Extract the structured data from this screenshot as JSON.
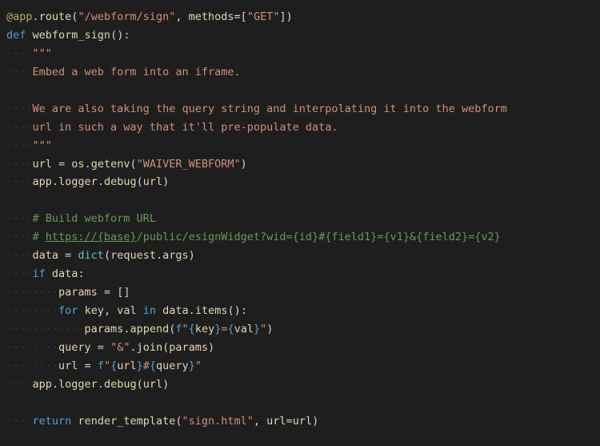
{
  "code": {
    "lines": [
      {
        "indent": 0,
        "segments": [
          {
            "cls": "dec",
            "t": "@app"
          },
          {
            "cls": "pun",
            "t": "."
          },
          {
            "cls": "fn",
            "t": "route"
          },
          {
            "cls": "pun",
            "t": "("
          },
          {
            "cls": "str",
            "t": "\"/webform/sign\""
          },
          {
            "cls": "pun",
            "t": ", "
          },
          {
            "cls": "var",
            "t": "methods"
          },
          {
            "cls": "op",
            "t": "="
          },
          {
            "cls": "pun",
            "t": "["
          },
          {
            "cls": "str",
            "t": "\"GET\""
          },
          {
            "cls": "pun",
            "t": "])"
          }
        ]
      },
      {
        "indent": 0,
        "segments": [
          {
            "cls": "def",
            "t": "def "
          },
          {
            "cls": "fn",
            "t": "webform_sign"
          },
          {
            "cls": "pun",
            "t": "():"
          }
        ]
      },
      {
        "indent": 1,
        "segments": [
          {
            "cls": "docstr",
            "t": "\"\"\""
          }
        ]
      },
      {
        "indent": 1,
        "segments": [
          {
            "cls": "docstr",
            "t": "Embed a web form into an iframe."
          }
        ]
      },
      {
        "indent": 0,
        "segments": [
          {
            "cls": "",
            "t": ""
          }
        ]
      },
      {
        "indent": 1,
        "segments": [
          {
            "cls": "docstr",
            "t": "We are also taking the query string and interpolating it into the webform"
          }
        ]
      },
      {
        "indent": 1,
        "segments": [
          {
            "cls": "docstr",
            "t": "url in such a way that it'll pre-populate data."
          }
        ]
      },
      {
        "indent": 1,
        "segments": [
          {
            "cls": "docstr",
            "t": "\"\"\""
          }
        ]
      },
      {
        "indent": 1,
        "segments": [
          {
            "cls": "var",
            "t": "url"
          },
          {
            "cls": "op",
            "t": " = "
          },
          {
            "cls": "var",
            "t": "os"
          },
          {
            "cls": "pun",
            "t": "."
          },
          {
            "cls": "fn",
            "t": "getenv"
          },
          {
            "cls": "pun",
            "t": "("
          },
          {
            "cls": "str",
            "t": "\"WAIVER_WEBFORM\""
          },
          {
            "cls": "pun",
            "t": ")"
          }
        ]
      },
      {
        "indent": 1,
        "segments": [
          {
            "cls": "var",
            "t": "app"
          },
          {
            "cls": "pun",
            "t": "."
          },
          {
            "cls": "var",
            "t": "logger"
          },
          {
            "cls": "pun",
            "t": "."
          },
          {
            "cls": "fn",
            "t": "debug"
          },
          {
            "cls": "pun",
            "t": "("
          },
          {
            "cls": "var",
            "t": "url"
          },
          {
            "cls": "pun",
            "t": ")"
          }
        ]
      },
      {
        "indent": 0,
        "segments": [
          {
            "cls": "",
            "t": ""
          }
        ]
      },
      {
        "indent": 1,
        "segments": [
          {
            "cls": "cmt",
            "t": "# Build webform URL"
          }
        ]
      },
      {
        "indent": 1,
        "segments": [
          {
            "cls": "cmt",
            "t": "# "
          },
          {
            "cls": "url",
            "t": "https://{base}"
          },
          {
            "cls": "cmt",
            "t": "/public/esignWidget?wid={id}#{field1}={v1}&{field2}={v2}"
          }
        ]
      },
      {
        "indent": 1,
        "segments": [
          {
            "cls": "var",
            "t": "data"
          },
          {
            "cls": "op",
            "t": " = "
          },
          {
            "cls": "builtin",
            "t": "dict"
          },
          {
            "cls": "pun",
            "t": "("
          },
          {
            "cls": "var",
            "t": "request"
          },
          {
            "cls": "pun",
            "t": "."
          },
          {
            "cls": "var",
            "t": "args"
          },
          {
            "cls": "pun",
            "t": ")"
          }
        ]
      },
      {
        "indent": 1,
        "segments": [
          {
            "cls": "kw",
            "t": "if"
          },
          {
            "cls": "",
            "t": " "
          },
          {
            "cls": "var",
            "t": "data"
          },
          {
            "cls": "pun",
            "t": ":"
          }
        ]
      },
      {
        "indent": 2,
        "segments": [
          {
            "cls": "var",
            "t": "params"
          },
          {
            "cls": "op",
            "t": " = "
          },
          {
            "cls": "pun",
            "t": "[]"
          }
        ]
      },
      {
        "indent": 2,
        "segments": [
          {
            "cls": "kw",
            "t": "for"
          },
          {
            "cls": "",
            "t": " "
          },
          {
            "cls": "var",
            "t": "key"
          },
          {
            "cls": "pun",
            "t": ", "
          },
          {
            "cls": "var",
            "t": "val"
          },
          {
            "cls": "",
            "t": " "
          },
          {
            "cls": "kw",
            "t": "in"
          },
          {
            "cls": "",
            "t": " "
          },
          {
            "cls": "var",
            "t": "data"
          },
          {
            "cls": "pun",
            "t": "."
          },
          {
            "cls": "fn",
            "t": "items"
          },
          {
            "cls": "pun",
            "t": "():"
          }
        ]
      },
      {
        "indent": 3,
        "segments": [
          {
            "cls": "var",
            "t": "params"
          },
          {
            "cls": "pun",
            "t": "."
          },
          {
            "cls": "fn",
            "t": "append"
          },
          {
            "cls": "pun",
            "t": "("
          },
          {
            "cls": "kw",
            "t": "f"
          },
          {
            "cls": "str",
            "t": "\""
          },
          {
            "cls": "kw",
            "t": "{"
          },
          {
            "cls": "var",
            "t": "key"
          },
          {
            "cls": "kw",
            "t": "}"
          },
          {
            "cls": "str",
            "t": "="
          },
          {
            "cls": "kw",
            "t": "{"
          },
          {
            "cls": "var",
            "t": "val"
          },
          {
            "cls": "kw",
            "t": "}"
          },
          {
            "cls": "str",
            "t": "\""
          },
          {
            "cls": "pun",
            "t": ")"
          }
        ]
      },
      {
        "indent": 2,
        "segments": [
          {
            "cls": "var",
            "t": "query"
          },
          {
            "cls": "op",
            "t": " = "
          },
          {
            "cls": "str",
            "t": "\"&\""
          },
          {
            "cls": "pun",
            "t": "."
          },
          {
            "cls": "fn",
            "t": "join"
          },
          {
            "cls": "pun",
            "t": "("
          },
          {
            "cls": "var",
            "t": "params"
          },
          {
            "cls": "pun",
            "t": ")"
          }
        ]
      },
      {
        "indent": 2,
        "segments": [
          {
            "cls": "var",
            "t": "url"
          },
          {
            "cls": "op",
            "t": " = "
          },
          {
            "cls": "kw",
            "t": "f"
          },
          {
            "cls": "str",
            "t": "\""
          },
          {
            "cls": "kw",
            "t": "{"
          },
          {
            "cls": "var",
            "t": "url"
          },
          {
            "cls": "kw",
            "t": "}"
          },
          {
            "cls": "str",
            "t": "#"
          },
          {
            "cls": "kw",
            "t": "{"
          },
          {
            "cls": "var",
            "t": "query"
          },
          {
            "cls": "kw",
            "t": "}"
          },
          {
            "cls": "str",
            "t": "\""
          }
        ]
      },
      {
        "indent": 1,
        "segments": [
          {
            "cls": "var",
            "t": "app"
          },
          {
            "cls": "pun",
            "t": "."
          },
          {
            "cls": "var",
            "t": "logger"
          },
          {
            "cls": "pun",
            "t": "."
          },
          {
            "cls": "fn",
            "t": "debug"
          },
          {
            "cls": "pun",
            "t": "("
          },
          {
            "cls": "var",
            "t": "url"
          },
          {
            "cls": "pun",
            "t": ")"
          }
        ]
      },
      {
        "indent": 0,
        "segments": [
          {
            "cls": "",
            "t": ""
          }
        ]
      },
      {
        "indent": 1,
        "segments": [
          {
            "cls": "kw",
            "t": "return"
          },
          {
            "cls": "",
            "t": " "
          },
          {
            "cls": "fn",
            "t": "render_template"
          },
          {
            "cls": "pun",
            "t": "("
          },
          {
            "cls": "str",
            "t": "\"sign.html\""
          },
          {
            "cls": "pun",
            "t": ", "
          },
          {
            "cls": "var",
            "t": "url"
          },
          {
            "cls": "op",
            "t": "="
          },
          {
            "cls": "var",
            "t": "url"
          },
          {
            "cls": "pun",
            "t": ")"
          }
        ]
      }
    ],
    "indent_marker": "····"
  }
}
